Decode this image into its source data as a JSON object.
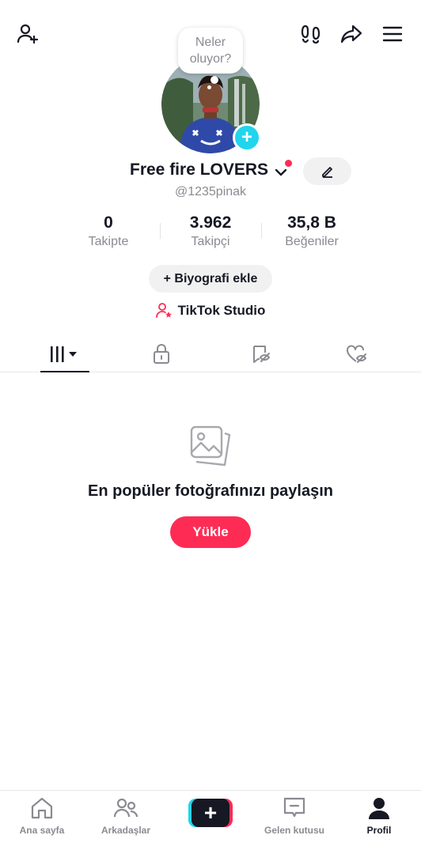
{
  "header": {
    "add_friend_icon": "person-plus-icon",
    "footprints_icon": "footprints-icon",
    "share_icon": "share-arrow-icon",
    "menu_icon": "hamburger-menu-icon"
  },
  "profile": {
    "bubble_text_line1": "Neler",
    "bubble_text_line2": "oluyor?",
    "name": "Free fire LOVERS",
    "handle": "@1235pinak",
    "add_photo_symbol": "+",
    "stats": [
      {
        "value": "0",
        "label": "Takipte"
      },
      {
        "value": "3.962",
        "label": "Takipçi"
      },
      {
        "value": "35,8 B",
        "label": "Beğeniler"
      }
    ],
    "bio_button": "+ Biyografi ekle",
    "studio_link": "TikTok Studio"
  },
  "tabs": [
    {
      "icon": "grid-videos-icon",
      "active": true
    },
    {
      "icon": "lock-icon",
      "active": false
    },
    {
      "icon": "reposts-hidden-icon",
      "active": false
    },
    {
      "icon": "liked-hidden-icon",
      "active": false
    }
  ],
  "empty_state": {
    "icon": "photos-icon",
    "title": "En popüler fotoğrafınızı paylaşın",
    "button": "Yükle"
  },
  "bottom_nav": [
    {
      "label": "Ana sayfa",
      "icon": "home-icon"
    },
    {
      "label": "Arkadaşlar",
      "icon": "friends-icon"
    },
    {
      "label": "",
      "icon": "create-plus-icon"
    },
    {
      "label": "Gelen kutusu",
      "icon": "inbox-icon"
    },
    {
      "label": "Profil",
      "icon": "profile-icon",
      "active": true
    }
  ],
  "colors": {
    "accent_red": "#fe2c55",
    "avatar_add_cyan": "#20d5ec",
    "text_primary": "#161823",
    "text_secondary": "#8a8b91"
  }
}
